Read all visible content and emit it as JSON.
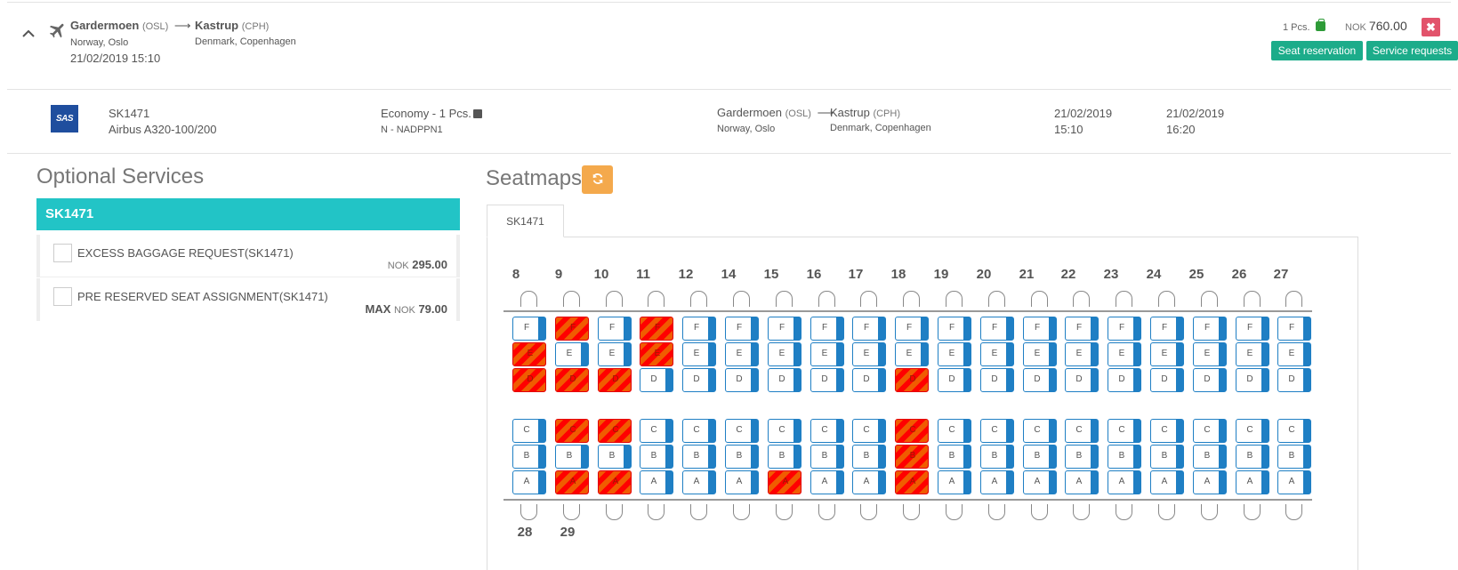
{
  "header": {
    "from": {
      "name": "Gardermoen",
      "code": "(OSL)",
      "sub": "Norway, Oslo"
    },
    "to": {
      "name": "Kastrup",
      "code": "(CPH)",
      "sub": "Denmark, Copenhagen"
    },
    "arrow": "⟶",
    "date": "21/02/2019 15:10",
    "pcs": "1 Pcs.",
    "currency": "NOK",
    "price": "760.00",
    "remove_icon": "✖",
    "seat_reservation_label": "Seat reservation",
    "service_requests_label": "Service requests"
  },
  "segment": {
    "airline_logo_text": "SAS",
    "flight": "SK1471",
    "aircraft": "Airbus A320-100/200",
    "cabin": "Economy - 1 Pcs.",
    "fare": "N - NADPPN1",
    "from": {
      "name": "Gardermoen",
      "code": "(OSL)",
      "sub": "Norway, Oslo"
    },
    "to": {
      "name": "Kastrup",
      "code": "(CPH)",
      "sub": "Denmark, Copenhagen"
    },
    "dep_date": "21/02/2019",
    "dep_time": "15:10",
    "arr_date": "21/02/2019",
    "arr_time": "16:20"
  },
  "optional_services": {
    "title": "Optional Services",
    "panel_title": "SK1471",
    "items": [
      {
        "label": "EXCESS BAGGAGE REQUEST(SK1471)",
        "prefix": "",
        "currency": "NOK",
        "price": "295.00"
      },
      {
        "label": "PRE RESERVED SEAT ASSIGNMENT(SK1471)",
        "prefix": "MAX",
        "currency": "NOK",
        "price": "79.00"
      }
    ]
  },
  "seatmaps": {
    "title": "Seatmaps",
    "refresh_icon": "refresh-icon",
    "tab_label": "SK1471",
    "colors": {
      "available": "#1f7fc4",
      "occupied": "#ff0000",
      "occupied_stripe": "#f05c00"
    },
    "letters_top": [
      "F",
      "E",
      "D"
    ],
    "letters_bottom": [
      "C",
      "B",
      "A"
    ],
    "rows": [
      {
        "num": "8",
        "occupied": [
          "E",
          "D"
        ]
      },
      {
        "num": "9",
        "occupied": [
          "F",
          "D",
          "C",
          "A"
        ]
      },
      {
        "num": "10",
        "occupied": [
          "D",
          "C",
          "A"
        ]
      },
      {
        "num": "11",
        "occupied": [
          "F",
          "E"
        ]
      },
      {
        "num": "12",
        "occupied": []
      },
      {
        "num": "14",
        "occupied": []
      },
      {
        "num": "15",
        "occupied": [
          "A"
        ]
      },
      {
        "num": "16",
        "occupied": []
      },
      {
        "num": "17",
        "occupied": []
      },
      {
        "num": "18",
        "occupied": [
          "D",
          "C",
          "B",
          "A"
        ]
      },
      {
        "num": "19",
        "occupied": []
      },
      {
        "num": "20",
        "occupied": []
      },
      {
        "num": "21",
        "occupied": []
      },
      {
        "num": "22",
        "occupied": []
      },
      {
        "num": "23",
        "occupied": []
      },
      {
        "num": "24",
        "occupied": []
      },
      {
        "num": "25",
        "occupied": []
      },
      {
        "num": "26",
        "occupied": []
      },
      {
        "num": "27",
        "occupied": []
      }
    ],
    "next_rows": [
      "28",
      "29"
    ]
  }
}
